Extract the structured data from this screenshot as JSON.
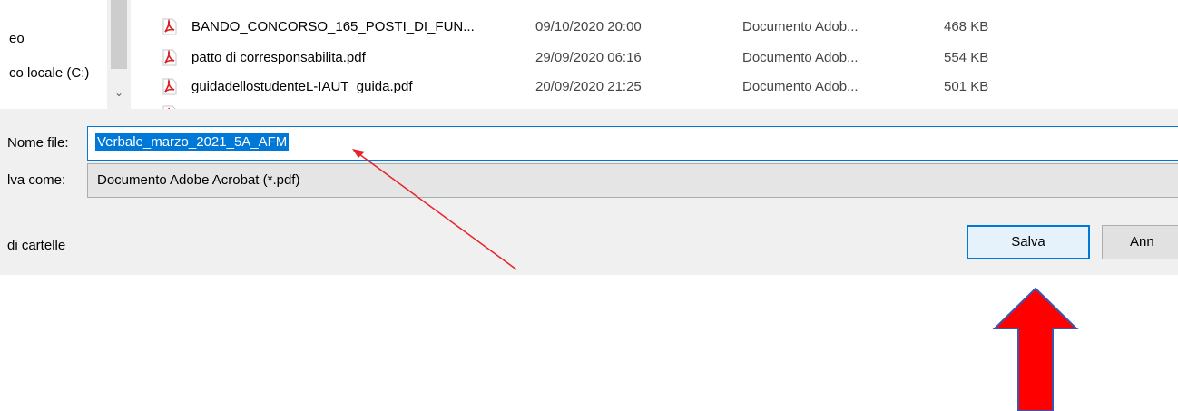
{
  "nav_pane": {
    "items": [
      "eo",
      "co locale (C:)"
    ],
    "scroll_down_glyph": "⌄"
  },
  "file_list": {
    "rows": [
      {
        "name": "BANDO_CONCORSO_165_POSTI_DI_FUN...",
        "date": "09/10/2020 20:00",
        "type": "Documento Adob...",
        "size": "468 KB"
      },
      {
        "name": "patto di corresponsabilita.pdf",
        "date": "29/09/2020 06:16",
        "type": "Documento Adob...",
        "size": "554 KB"
      },
      {
        "name": "guidadellostudenteL-IAUT_guida.pdf",
        "date": "20/09/2020 21:25",
        "type": "Documento Adob...",
        "size": "501 KB"
      }
    ]
  },
  "save_form": {
    "filename_label": "Nome file:",
    "filename_value": "Verbale_marzo_2021_5A_AFM",
    "savetype_label": "lva come:",
    "savetype_value": "Documento Adobe Acrobat (*.pdf)",
    "folders_toggle": "di cartelle",
    "save_button": "Salva",
    "cancel_button": "Ann"
  },
  "colors": {
    "accent": "#0078d7",
    "panel_bg": "#f0f0f0",
    "annotation_line": "#e8242b",
    "annotation_arrow": "#ff0000",
    "annotation_arrow_outline": "#3b55b0"
  }
}
